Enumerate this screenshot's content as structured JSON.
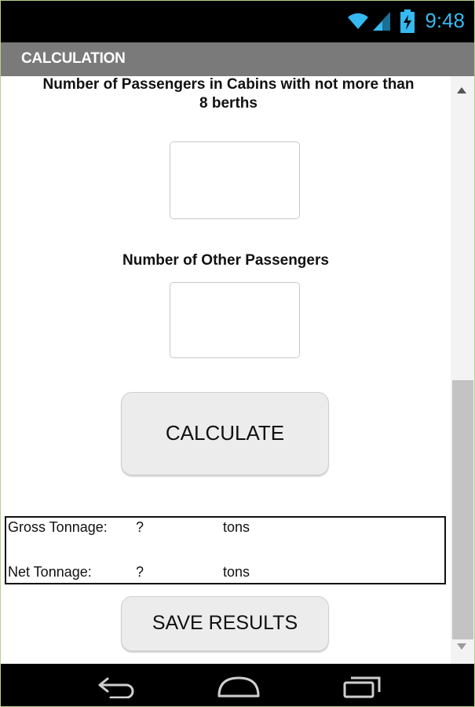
{
  "status_bar": {
    "time": "9:48",
    "icons": [
      "wifi-icon",
      "signal-icon",
      "battery-charging-icon"
    ]
  },
  "title_bar": {
    "title": "CALCULATION"
  },
  "form": {
    "cabins_label_line1": "Number of Passengers in Cabins with not more than",
    "cabins_label_line2": "8 berths",
    "cabins_value": "",
    "other_label": "Number of Other Passengers",
    "other_value": "",
    "calculate_label": "CALCULATE"
  },
  "results": {
    "gross_label": "Gross Tonnage:",
    "gross_value": "?",
    "gross_unit": "tons",
    "net_label": "Net Tonnage:",
    "net_value": "?",
    "net_unit": "tons"
  },
  "save_label": "SAVE RESULTS",
  "nav_bar": {
    "icons": [
      "back-icon",
      "home-icon",
      "recent-apps-icon"
    ]
  },
  "colors": {
    "accent": "#35b9f0",
    "title_bar": "#7a7a7a",
    "button_bg": "#ececec"
  }
}
